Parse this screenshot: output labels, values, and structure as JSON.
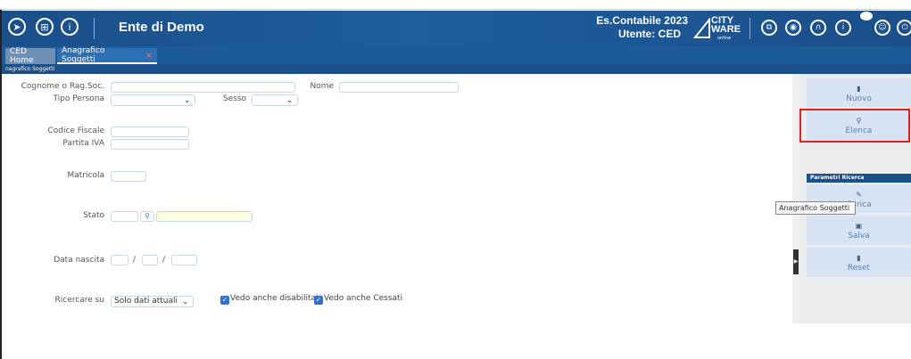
{
  "header": {
    "title": "Ente di Demo",
    "year_label": "Es.Contabile 2023",
    "user_label": "Utente: CED",
    "logo_line1": "CITY",
    "logo_line2": "WARE",
    "logo_sub": "online",
    "left_icons": [
      "rocket-icon",
      "apps-grid-icon",
      "info-icon"
    ],
    "right_icons": [
      "copy-icon",
      "layers-icon",
      "headset-icon",
      "help-icon",
      "user-icon",
      "power-icon"
    ]
  },
  "tabs": [
    {
      "label": "CED Home"
    },
    {
      "label": "Anagrafico Soggetti",
      "close": "×"
    }
  ],
  "breadcrumb": "nagrafico Soggetti",
  "form": {
    "cognome_label": "Cognome o Rag.Soc.",
    "nome_label": "Nome",
    "tipo_persona_label": "Tipo Persona",
    "sesso_label": "Sesso",
    "codice_fiscale_label": "Codice Fiscale",
    "partita_iva_label": "Partita IVA",
    "matricola_label": "Matricola",
    "stato_label": "Stato",
    "data_nascita_label": "Data nascita",
    "date_sep": "/",
    "ricercare_label": "Ricercare su",
    "ricercare_value": "Solo dati attuali",
    "check1_label": "Vedo anche disabilitati",
    "check2_label": "Vedo anche Cessati",
    "caret": "⌄"
  },
  "right_panel": {
    "nuovo": "Nuovo",
    "elenca": "Elenca",
    "param_header": "Parametri Ricerca",
    "carica": "Carica",
    "salva": "Salva",
    "reset": "Reset"
  },
  "tooltip": "Anagrafico Soggetti",
  "colors": {
    "header": "#1a4f8a",
    "highlight": "#e02020",
    "button_bg": "#d7e2f2"
  }
}
